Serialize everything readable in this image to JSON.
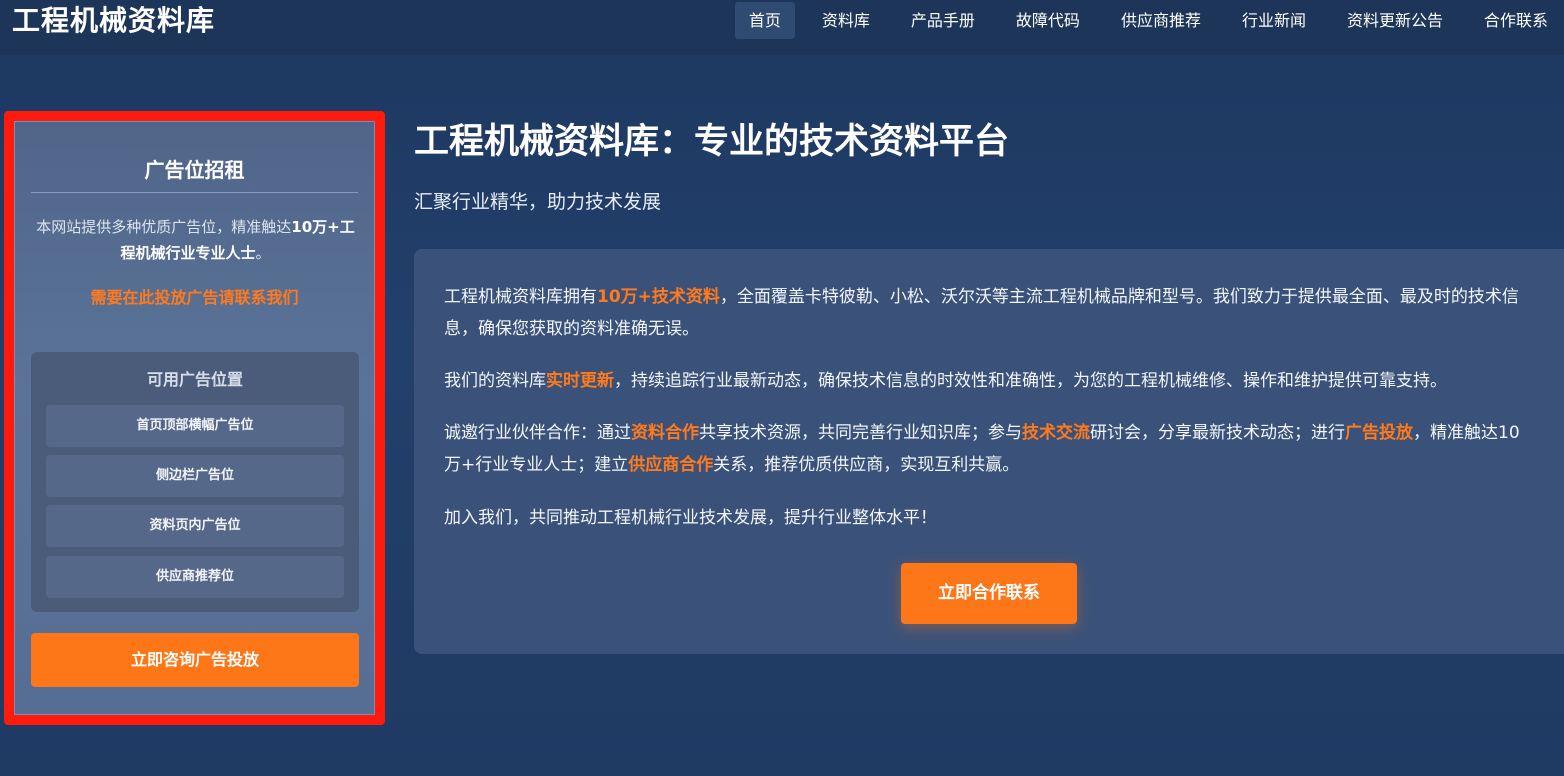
{
  "header": {
    "logo": "工程机械资料库",
    "nav": [
      {
        "label": "首页",
        "active": true
      },
      {
        "label": "资料库",
        "active": false
      },
      {
        "label": "产品手册",
        "active": false
      },
      {
        "label": "故障代码",
        "active": false
      },
      {
        "label": "供应商推荐",
        "active": false
      },
      {
        "label": "行业新闻",
        "active": false
      },
      {
        "label": "资料更新公告",
        "active": false
      },
      {
        "label": "合作联系",
        "active": false
      }
    ]
  },
  "sidebar": {
    "title": "广告位招租",
    "desc_prefix": "本网站提供多种优质广告位，精准触达",
    "desc_bold": "10万+工程机械行业专业人士",
    "desc_suffix": "。",
    "contact": "需要在此投放广告请联系我们",
    "slots_heading": "可用广告位置",
    "slots": [
      "首页顶部横幅广告位",
      "侧边栏广告位",
      "资料页内广告位",
      "供应商推荐位"
    ],
    "button": "立即咨询广告投放"
  },
  "main": {
    "title": "工程机械资料库：专业的技术资料平台",
    "subtitle": "汇聚行业精华，助力技术发展",
    "p1": {
      "a": "工程机械资料库拥有",
      "h1": "10万+技术资料",
      "b": "，全面覆盖卡特彼勒、小松、沃尔沃等主流工程机械品牌和型号。我们致力于提供最全面、最及时的技术信息，确保您获取的资料准确无误。"
    },
    "p2": {
      "a": "我们的资料库",
      "h1": "实时更新",
      "b": "，持续追踪行业最新动态，确保技术信息的时效性和准确性，为您的工程机械维修、操作和维护提供可靠支持。"
    },
    "p3": {
      "a": "诚邀行业伙伴合作：通过",
      "h1": "资料合作",
      "b": "共享技术资源，共同完善行业知识库；参与",
      "h2": "技术交流",
      "c": "研讨会，分享最新技术动态；进行",
      "h3": "广告投放",
      "d": "，精准触达10万+行业专业人士；建立",
      "h4": "供应商合作",
      "e": "关系，推荐优质供应商，实现互利共赢。"
    },
    "p4": "加入我们，共同推动工程机械行业技术发展，提升行业整体水平！",
    "button": "立即合作联系"
  },
  "colors": {
    "accent": "#fd7617",
    "highlight": "#ff7a1c",
    "sidebar_border": "#ff1a0e"
  }
}
